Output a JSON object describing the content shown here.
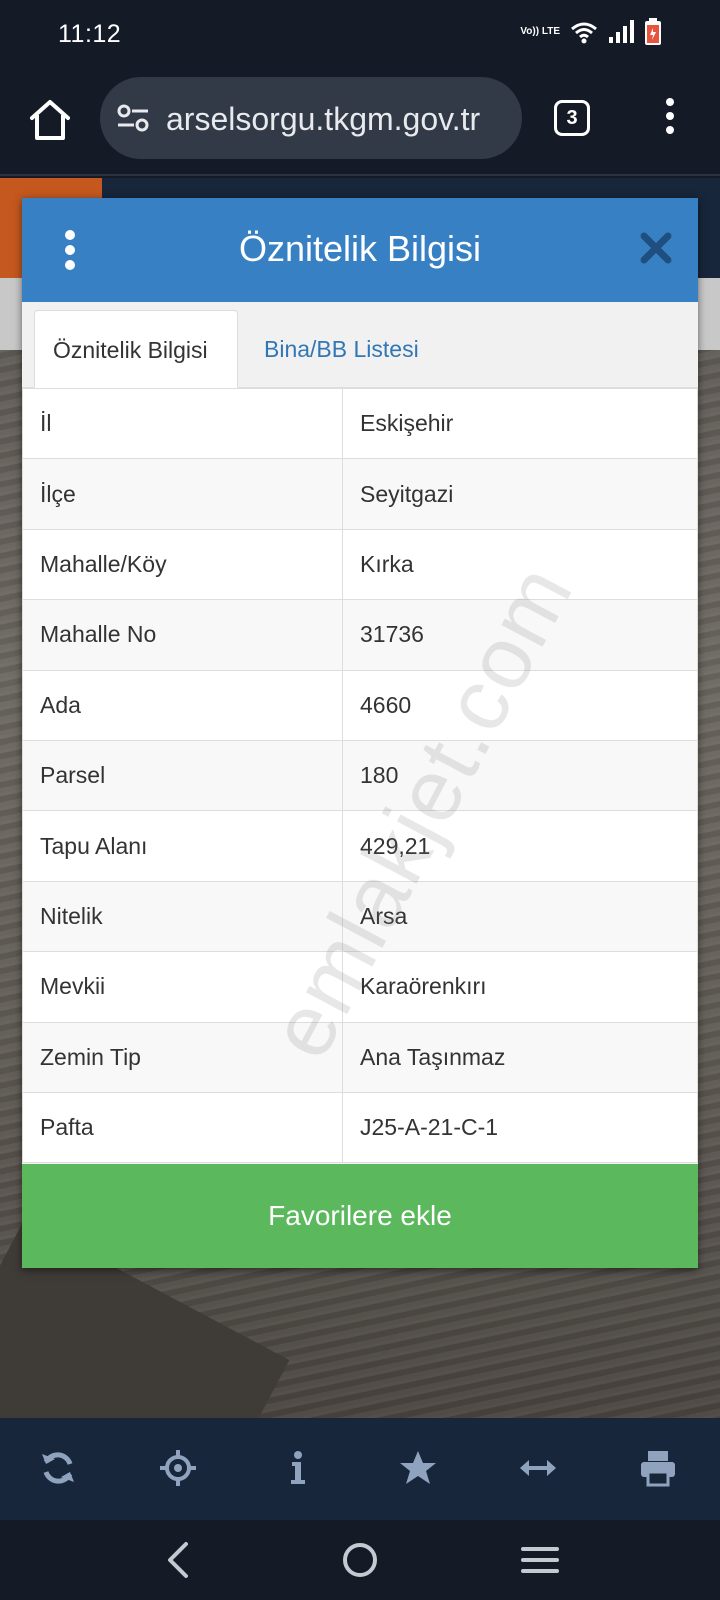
{
  "status_bar": {
    "time": "11:12",
    "volte_label": "Vo)) LTE"
  },
  "browser": {
    "url": "arselsorgu.tkgm.gov.tr",
    "tab_count": "3"
  },
  "modal": {
    "title": "Öznitelik Bilgisi",
    "tabs": [
      {
        "label": "Öznitelik Bilgisi",
        "active": true
      },
      {
        "label": "Bina/BB Listesi",
        "active": false
      }
    ],
    "rows": [
      {
        "key": "İl",
        "value": "Eskişehir"
      },
      {
        "key": "İlçe",
        "value": "Seyitgazi"
      },
      {
        "key": "Mahalle/Köy",
        "value": "Kırka"
      },
      {
        "key": "Mahalle No",
        "value": "31736"
      },
      {
        "key": "Ada",
        "value": "4660"
      },
      {
        "key": "Parsel",
        "value": "180"
      },
      {
        "key": "Tapu Alanı",
        "value": "429,21"
      },
      {
        "key": "Nitelik",
        "value": "Arsa"
      },
      {
        "key": "Mevkii",
        "value": "Karaörenkırı"
      },
      {
        "key": "Zemin Tip",
        "value": "Ana Taşınmaz"
      },
      {
        "key": "Pafta",
        "value": "J25-A-21-C-1"
      }
    ],
    "favorite_button": "Favorilere ekle"
  },
  "watermark": "emlakjet.com",
  "toolbar": {
    "icons": [
      "refresh-icon",
      "locate-icon",
      "info-icon",
      "star-icon",
      "measure-icon",
      "print-icon"
    ]
  },
  "colors": {
    "header_blue": "#3780c4",
    "favorite_green": "#5cb85c",
    "tab_link_blue": "#3277b5",
    "toolbar_icon": "#8fa3bf",
    "dark_bg": "#151b26"
  }
}
